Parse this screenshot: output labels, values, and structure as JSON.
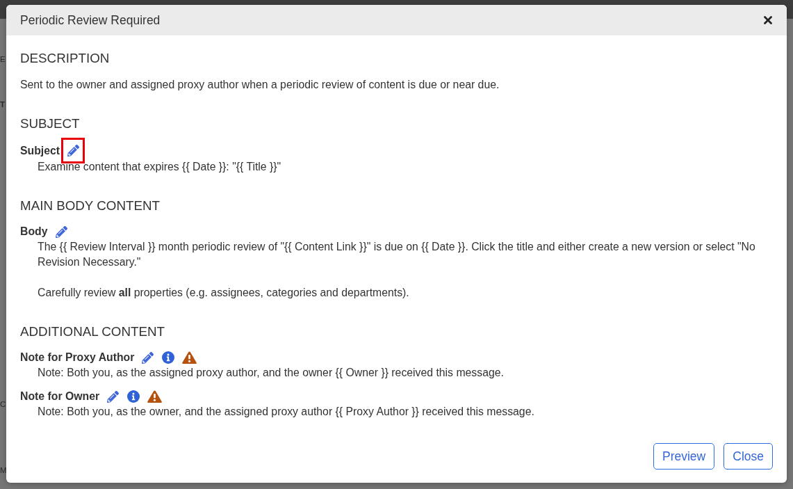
{
  "backdrop": {
    "edge_letters": [
      {
        "text": "E",
        "kind": "plain"
      },
      {
        "text": "T",
        "kind": "bold"
      },
      {
        "text": "C",
        "kind": "plain"
      },
      {
        "text": "M",
        "kind": "plain"
      }
    ]
  },
  "dialog": {
    "title": "Periodic Review Required"
  },
  "sections": [
    {
      "heading": "DESCRIPTION",
      "kind": "text",
      "text": "Sent to the owner and assigned proxy author when a periodic review of content is due or near due."
    },
    {
      "heading": "SUBJECT",
      "kind": "fields",
      "fields": [
        {
          "label": "Subject",
          "kind": "template",
          "highlighted": true,
          "paragraphs": [
            "Examine content that expires {{ Date }}: \"{{ Title }}\""
          ]
        }
      ]
    },
    {
      "heading": "MAIN BODY CONTENT",
      "kind": "fields",
      "fields": [
        {
          "label": "Body",
          "kind": "template",
          "highlighted": false,
          "paragraphs": [
            "The {{ Review Interval }} month periodic review of \"{{ Content Link }}\" is due on {{ Date }}. Click the title and either create a new version or select \"No Revision Necessary.\"",
            "Carefully review **all** properties (e.g. assignees, categories and departments)."
          ]
        }
      ]
    },
    {
      "heading": "ADDITIONAL CONTENT",
      "kind": "fields",
      "fields": [
        {
          "label": "Note for Proxy Author",
          "kind": "note",
          "highlighted": false,
          "paragraphs": [
            "Note: Both you, as the assigned proxy author, and the owner {{ Owner }} received this message."
          ]
        },
        {
          "label": "Note for Owner",
          "kind": "note",
          "highlighted": false,
          "paragraphs": [
            "Note: Both you, as the owner, and the assigned proxy author {{ Proxy Author }} received this message."
          ]
        }
      ]
    }
  ],
  "buttons": [
    {
      "label": "Preview"
    },
    {
      "label": "Close"
    }
  ]
}
